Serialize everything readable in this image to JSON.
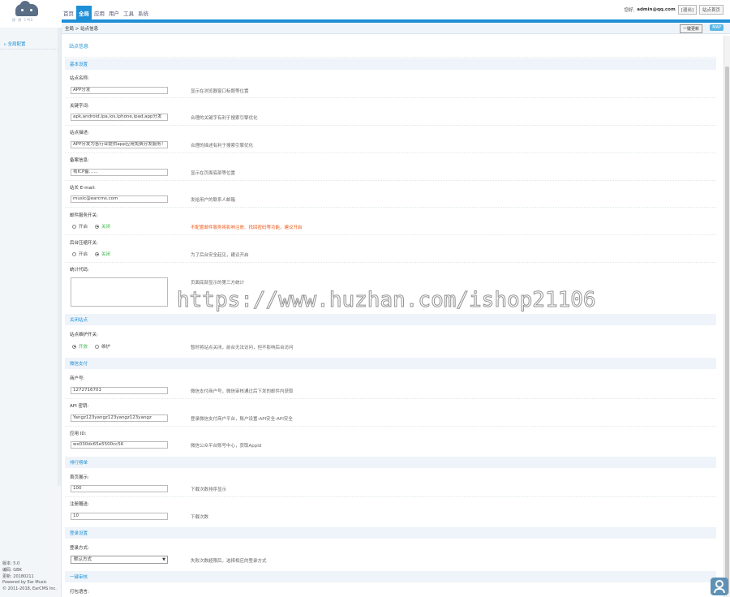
{
  "logo": {
    "sub": "理 想 CMS"
  },
  "topnav": [
    "首页",
    "全局",
    "应用",
    "用户",
    "工具",
    "系统"
  ],
  "header": {
    "greeting": "您好,",
    "email": "admin@qq.com",
    "logout": "[退出]",
    "site_btn": "站点首页"
  },
  "breadcrumb": "全局 > 站点信息",
  "buttons": {
    "update": "一键更新",
    "map": "MAP"
  },
  "sidebar": {
    "item": "全局配置",
    "footer": [
      "版本: 5.0",
      "编码: GBK",
      "更新: 20180211",
      "Powered by Ear Music",
      "© 2011-2018, EarCMS Inc."
    ]
  },
  "page_title": "站点信息",
  "sections": {
    "basic": "基本设置",
    "close": "关闭站点",
    "pay": "微信支付",
    "rank": "排行榜单",
    "auth": "登录设置",
    "onekey": "一键审核"
  },
  "fields": {
    "site_name": {
      "label": "站点名称:",
      "value": "APP分发",
      "hint": "显示在浏览器窗口标题等位置"
    },
    "keywords": {
      "label": "关键字词:",
      "value": "apk,android,ipa,ios,iphone,ipad,app分发",
      "hint": "合理的关键字有利于搜索引擎优化"
    },
    "description": {
      "label": "站点描述:",
      "value": "APP分发为各行业提供app应用免费分发服务！",
      "hint": "合理的描述有利于搜索引擎优化"
    },
    "copyright": {
      "label": "备案信息:",
      "value": "粤ICP备……",
      "hint": "显示在页面底部等位置"
    },
    "email": {
      "label": "站长 E-mail:",
      "value": "music@earcms.com",
      "hint": "发给用户的联系人邮箱"
    },
    "mail_verify": {
      "label": "邮件服务开关:",
      "opt_on": "开启",
      "opt_off": "关闭",
      "hint": "不配置邮件服务将影响注册、找回密码等功能，建议开启"
    },
    "gzip": {
      "label": "后台压缩开关:",
      "opt_on": "开启",
      "opt_off": "关闭",
      "hint": "为了后台安全起见，建议开启"
    },
    "stat_code": {
      "label": "统计代码:",
      "hint": "页面底部显示的第三方统计"
    },
    "close_switch": {
      "label": "站点维护开关:",
      "opt_on": "开放",
      "opt_off": "维护",
      "hint": "暂时将站点关闭，前台无法访问，但不影响后台访问"
    },
    "mchid": {
      "label": "商户号:",
      "value": "1272716701",
      "hint": "微信支付商户号，微信审核通过后下发的邮件内获取"
    },
    "api_key": {
      "label": "API 密钥:",
      "value": "Yangz123yangz123yangz123yangz",
      "hint": "登录微信支付商户平台，账户设置-API安全-API安全"
    },
    "appid": {
      "label": "应用 ID:",
      "value": "wx030dc65e5500cc56",
      "hint": "微信公众平台账号中心，获取AppId"
    },
    "rank_days": {
      "label": "首页展示:",
      "value": "100",
      "hint": "下载次数排序显示"
    },
    "rank_num": {
      "label": "注册赠送:",
      "value": "10",
      "hint": "下载次数"
    },
    "login_mode": {
      "label": "登录方式:",
      "value": "默认方式",
      "hint": "失败次数超限后，选择相应的登录方式"
    },
    "onekey_check": {
      "label": "打包语言:"
    }
  },
  "watermark": "https://www.huzhan.com/ishop21106"
}
